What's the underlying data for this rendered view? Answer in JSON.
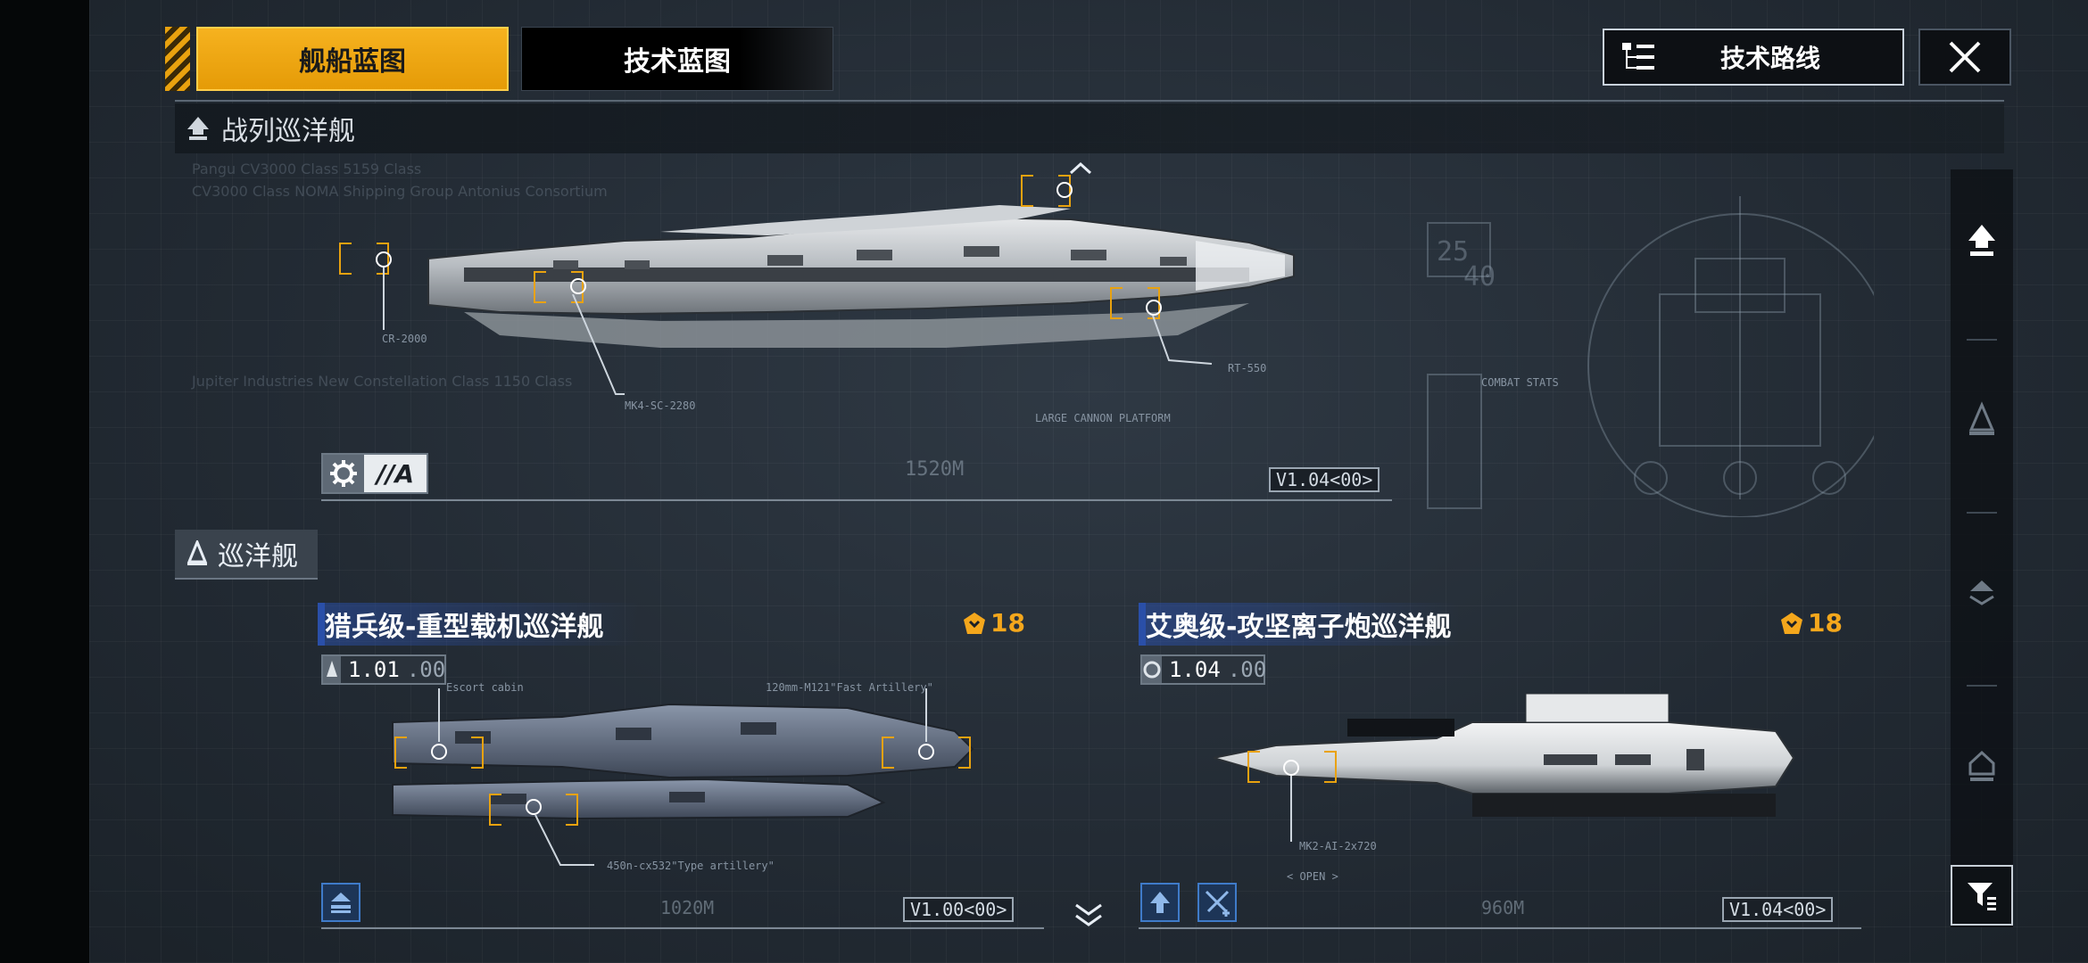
{
  "tabs": {
    "ship_blueprint": "舰船蓝图",
    "tech_blueprint": "技术蓝图",
    "tech_route": "技术路线"
  },
  "sections": {
    "battlecruiser": "战列巡洋舰",
    "cruiser": "巡洋舰"
  },
  "battlecruiser": {
    "grade": "//A",
    "version": "V1.04<00>",
    "length": "1520M",
    "labels": {
      "weapon1": "CR-2000",
      "weapon2": "MK4-SC-2280",
      "weapon3": "RT-550",
      "platform": "LARGE CANNON PLATFORM",
      "stats": "COMBAT STATS"
    },
    "bg_text": {
      "line1": "Pangu CV3000 Class 5159 Class",
      "line2": "CV3000 Class NOMA Shipping Group Antonius Consortium",
      "line3": "Jupiter Industries  New Constellation Class 1150 Class"
    }
  },
  "cruisers": [
    {
      "title": "猎兵级-重型载机巡洋舰",
      "rank": "18",
      "level": "1.01",
      "level_suffix": ".00",
      "version": "V1.00<00>",
      "length": "1020M",
      "labels": {
        "escort": "Escort cabin",
        "fast_artillery": "120mm-M121\"Fast Artillery\"",
        "type_artillery": "450n-cx532\"Type artillery\""
      }
    },
    {
      "title": "艾奥级-攻坚离子炮巡洋舰",
      "rank": "18",
      "level": "1.04",
      "level_suffix": ".00",
      "version": "V1.04<00>",
      "length": "960M",
      "labels": {
        "weapon": "MK2-AI-2x720",
        "open": "< OPEN >"
      }
    }
  ],
  "colors": {
    "accent": "#f4a71c",
    "blue": "#2a4fa8",
    "bg": "#262e37"
  }
}
